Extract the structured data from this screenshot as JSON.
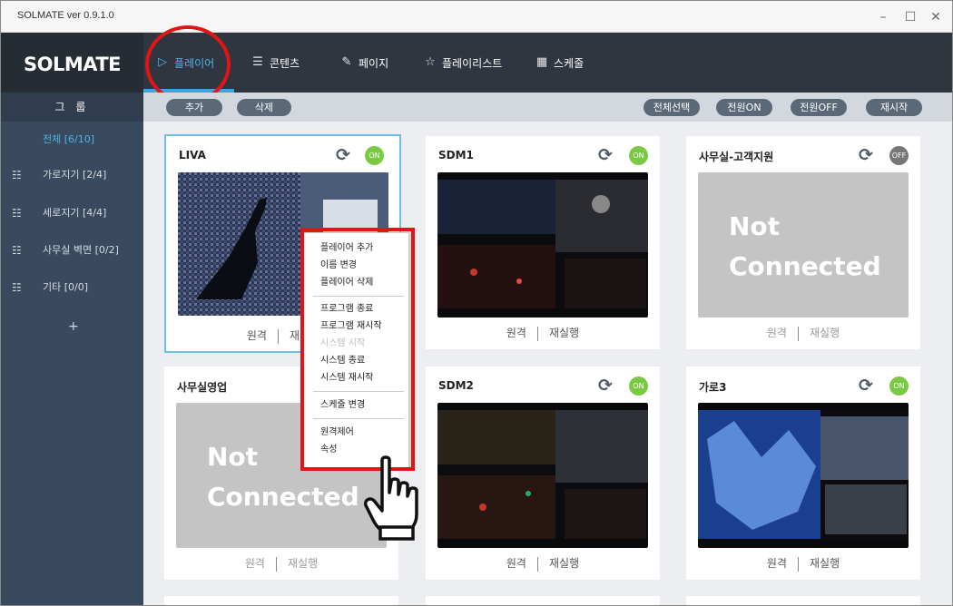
{
  "window": {
    "title": "SOLMATE  ver 0.9.1.0",
    "min": "–",
    "max": "☐",
    "close": "✕"
  },
  "logo": "SOLMATE",
  "nav": [
    {
      "label": "플레이어",
      "icon": "▷"
    },
    {
      "label": "콘텐츠",
      "icon": "☰"
    },
    {
      "label": "페이지",
      "icon": "✎"
    },
    {
      "label": "플레이리스트",
      "icon": "☆"
    },
    {
      "label": "스케줄",
      "icon": "▦"
    }
  ],
  "sidebar": {
    "title": "그 룹",
    "items": [
      {
        "label": "전체  [6/10]"
      },
      {
        "label": "가로지기  [2/4]"
      },
      {
        "label": "세로지기  [4/4]"
      },
      {
        "label": "사무실 벽면  [0/2]"
      },
      {
        "label": "기타  [0/0]"
      }
    ],
    "add": "+"
  },
  "toolbar": {
    "add": "추가",
    "delete": "삭제",
    "select_all": "전체선택",
    "power_on": "전원ON",
    "power_off": "전원OFF",
    "restart": "재시작"
  },
  "cards": [
    {
      "name": "LIVA",
      "power": "ON",
      "remote": "원격",
      "rerun": "재실행"
    },
    {
      "name": "SDM1",
      "power": "ON",
      "remote": "원격",
      "rerun": "재실행"
    },
    {
      "name": "사무실-고객지원",
      "power": "OFF",
      "status": "Not Connected",
      "remote": "원격",
      "rerun": "재실행"
    },
    {
      "name": "사무실영업",
      "power": "",
      "status": "Not Connected",
      "remote": "원격",
      "rerun": "재실행"
    },
    {
      "name": "SDM2",
      "power": "ON",
      "remote": "원격",
      "rerun": "재실행"
    },
    {
      "name": "가로3",
      "power": "ON",
      "remote": "원격",
      "rerun": "재실행"
    }
  ],
  "nc_line1": "Not",
  "nc_line2": "Connected",
  "context_menu": {
    "items": [
      "플레이어 추가",
      "이름 변경",
      "플레이어 삭제",
      "프로그램 종료",
      "프로그램 재시작",
      "시스템 시작",
      "시스템 종료",
      "시스템 재시작",
      "스케줄 변경",
      "원격제어",
      "속성"
    ]
  }
}
